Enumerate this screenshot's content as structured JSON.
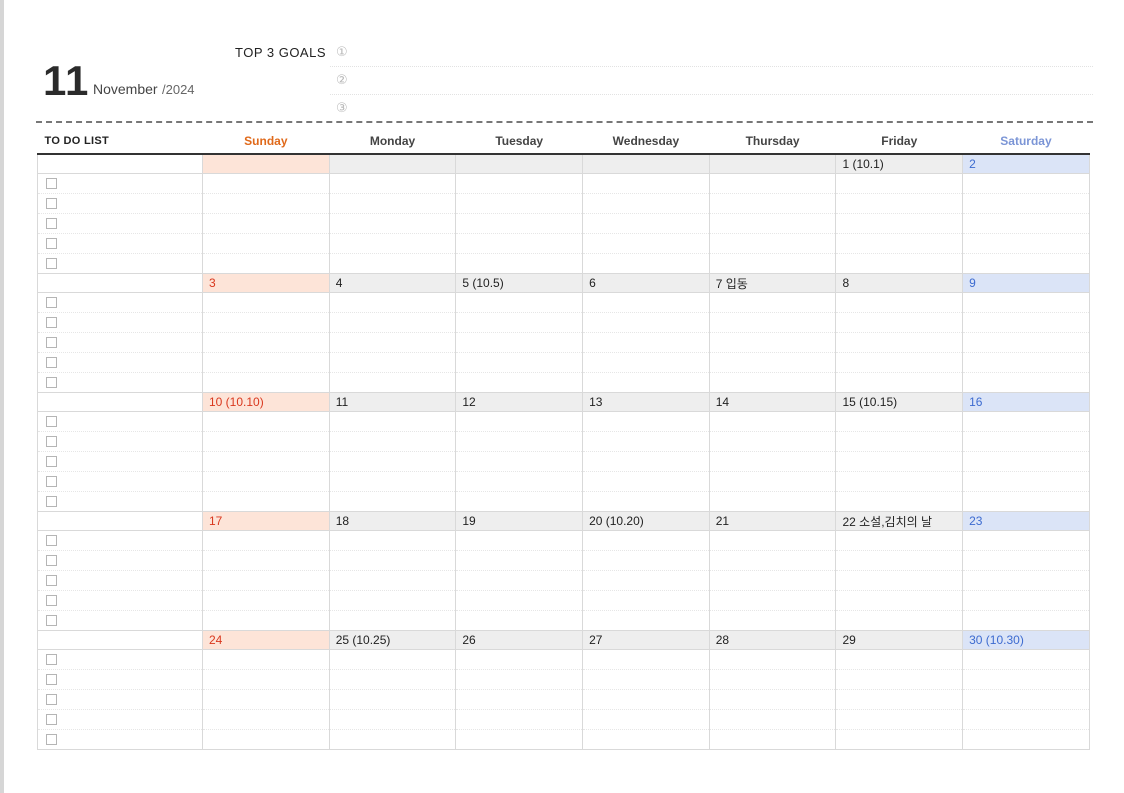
{
  "header": {
    "month_number": "11",
    "month_name": "November",
    "year": "/2024",
    "goals_title": "TOP 3 GOALS",
    "goal_markers": [
      "①",
      "②",
      "③"
    ]
  },
  "table": {
    "todo_label": "TO DO LIST",
    "days": [
      "Sunday",
      "Monday",
      "Tuesday",
      "Wednesday",
      "Thursday",
      "Friday",
      "Saturday"
    ],
    "weeks": [
      [
        "",
        "",
        "",
        "",
        "",
        "1  (10.1)",
        "2"
      ],
      [
        "3",
        "4",
        "5  (10.5)",
        "6",
        "7  입동",
        "8",
        "9"
      ],
      [
        "10  (10.10)",
        "11",
        "12",
        "13",
        "14",
        "15  (10.15)",
        "16"
      ],
      [
        "17",
        "18",
        "19",
        "20  (10.20)",
        "21",
        "22  소설,김치의 날",
        "23"
      ],
      [
        "24",
        "25  (10.25)",
        "26",
        "27",
        "28",
        "29",
        "30  (10.30)"
      ]
    ]
  },
  "colors": {
    "sunday_text": "#e0691a",
    "saturday_text": "#7b95d6",
    "sunday_fill": "#fde4d8",
    "saturday_fill": "#dbe4f7"
  }
}
